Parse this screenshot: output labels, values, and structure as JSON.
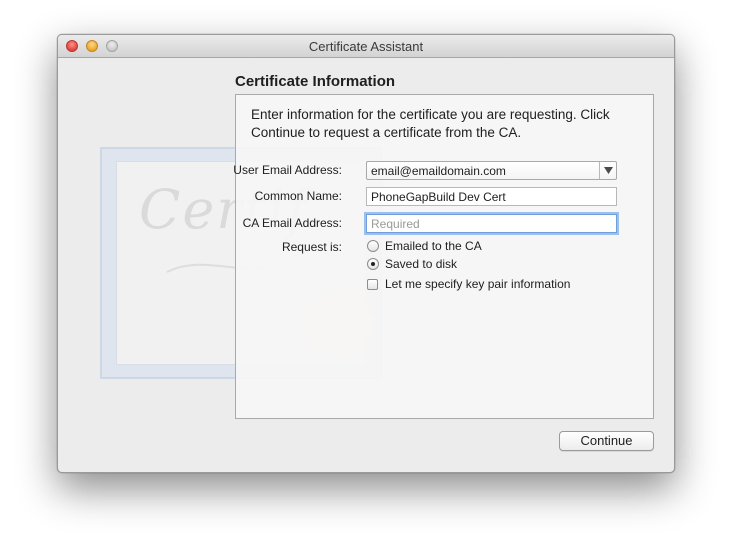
{
  "window": {
    "title": "Certificate Assistant"
  },
  "artwork": {
    "script_text": "Certif"
  },
  "section": {
    "title": "Certificate Information",
    "description": "Enter information for the certificate you are requesting. Click Continue to request a certificate from the CA."
  },
  "form": {
    "user_email_label": "User Email Address:",
    "user_email_value": "email@emaildomain.com",
    "common_name_label": "Common Name:",
    "common_name_value": "PhoneGapBuild Dev Cert",
    "ca_email_label": "CA Email Address:",
    "ca_email_value": "",
    "ca_email_placeholder": "Required",
    "request_label": "Request is:",
    "options": {
      "emailed_label": "Emailed to the CA",
      "emailed_selected": false,
      "saved_label": "Saved to disk",
      "saved_selected": true,
      "keypair_label": "Let me specify key pair information",
      "keypair_checked": false
    }
  },
  "footer": {
    "continue_label": "Continue"
  },
  "icons": {
    "close": "close-button-icon",
    "minimize": "minimize-button-icon",
    "zoom": "zoom-button-icon",
    "popup": "chevron-down-icon",
    "seal": "seal-icon"
  },
  "colors": {
    "focus_ring": "#9cc0ee",
    "close": "#e0443e",
    "minimize": "#e9a824",
    "zoom": "#c9c9c9"
  }
}
